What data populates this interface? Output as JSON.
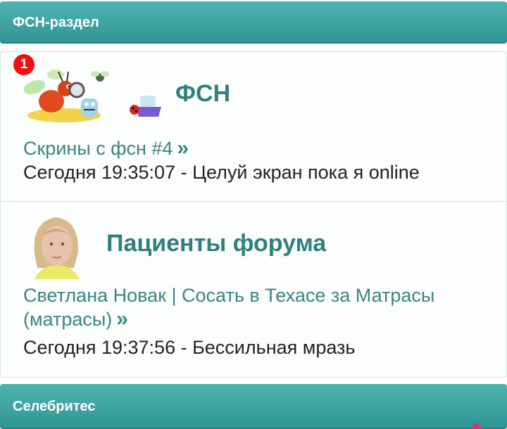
{
  "sections": {
    "fsn": {
      "header": "ФСН-раздел"
    },
    "celebrities": {
      "header": "Селебритес"
    }
  },
  "forums": [
    {
      "badge": "1",
      "icon": "fsn-cartoon-insects-icon",
      "title": "ФСН",
      "topic": "Скрины с фсн #4",
      "last_post": "Сегодня 19:35:07 - Целуй экран пока я online"
    },
    {
      "icon": "patient-avatar",
      "title": "Пациенты форума",
      "topic_line1": "Светлана Новак | Сосать в Техасе за Матрасы",
      "topic_line2": "(матрасы)",
      "last_post": "Сегодня 19:37:56 - Бессильная мразь"
    }
  ],
  "colors": {
    "header": "#3aa3a1",
    "link": "#3a8582",
    "badge": "#ee1111"
  }
}
